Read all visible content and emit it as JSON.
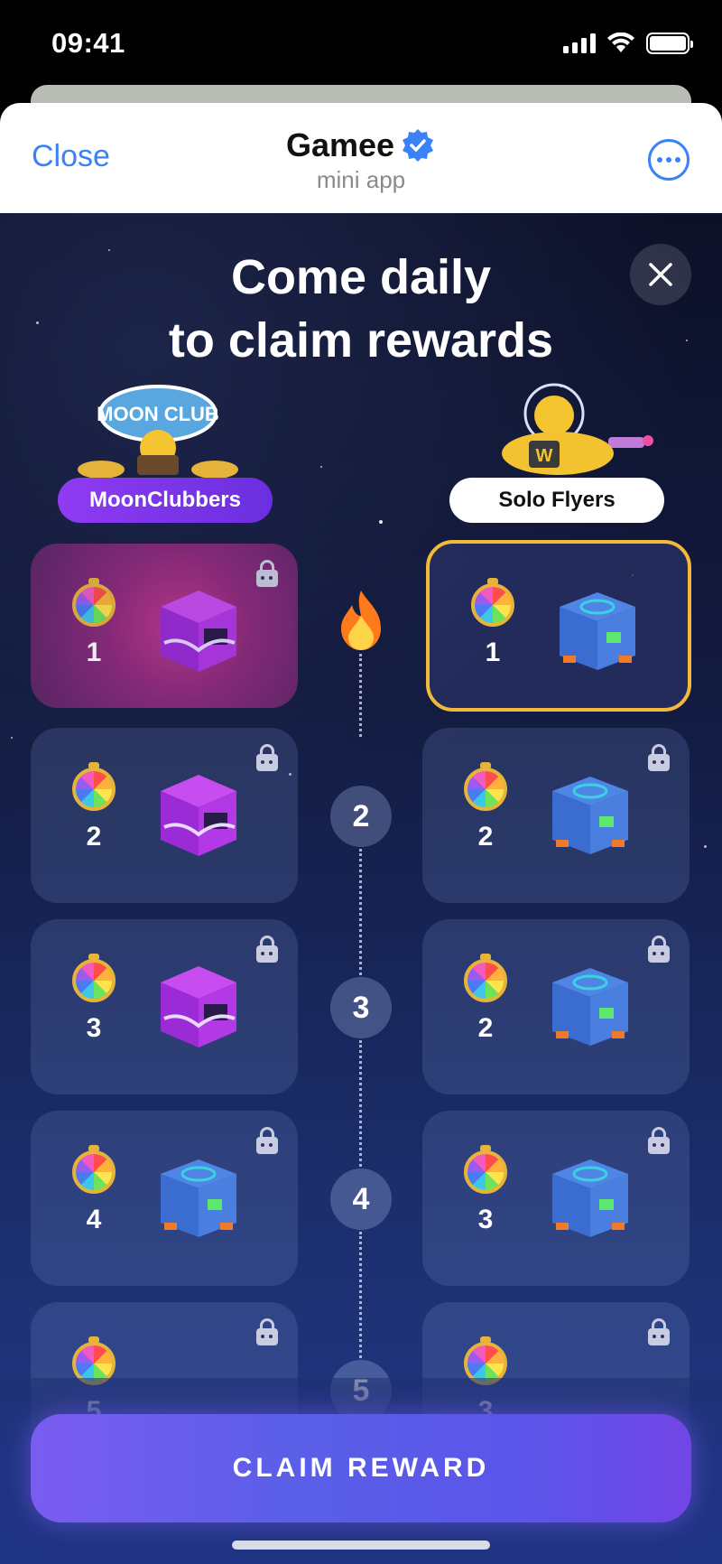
{
  "status": {
    "time": "09:41"
  },
  "header": {
    "close_label": "Close",
    "app_name": "Gamee",
    "subtitle": "mini app"
  },
  "game": {
    "headline_line1": "Come daily",
    "headline_line2": "to claim rewards",
    "teams": {
      "left": "MoonClubbers",
      "right": "Solo Flyers"
    },
    "left_rewards": [
      "1",
      "2",
      "3",
      "4",
      "5"
    ],
    "right_rewards": [
      "1",
      "2",
      "2",
      "3",
      "3"
    ],
    "days": [
      "2",
      "3",
      "4",
      "5"
    ]
  },
  "footer": {
    "claim_label": "CLAIM REWARD"
  },
  "colors": {
    "accent": "#3a82f7",
    "claim_button": "#5b55e9",
    "highlight_border": "#f3b93a",
    "team_pill": "#8f3bf2"
  },
  "icons": [
    "signal-icon",
    "wifi-icon",
    "battery-icon",
    "verified-badge-icon",
    "more-icon",
    "close-icon",
    "lock-icon",
    "spin-wheel-icon",
    "mystery-box-icon",
    "fire-icon"
  ]
}
